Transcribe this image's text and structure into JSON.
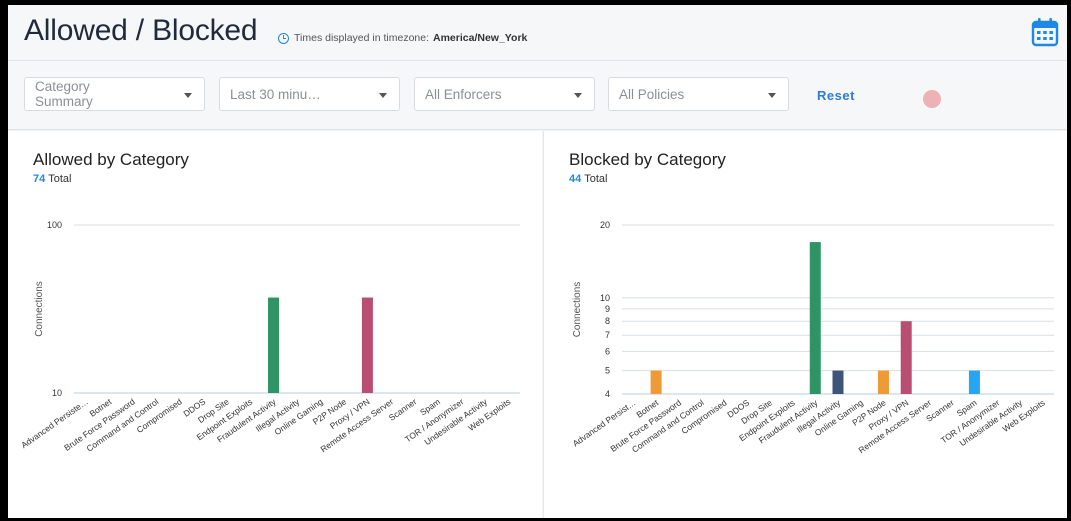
{
  "page": {
    "title": "Allowed / Blocked",
    "tz_label": "Times displayed in timezone:",
    "tz_value": "America/New_York"
  },
  "filters": {
    "category_line1": "Category",
    "category_line2": "Summary",
    "time_range": "Last 30 minu…",
    "enforcers": "All Enforcers",
    "policies": "All Policies",
    "reset_label": "Reset"
  },
  "icons": {
    "timezone": "clock-icon",
    "calendar": "calendar-icon"
  },
  "colors": {
    "accent": "#1e88e5",
    "green": "#2e9464",
    "rose": "#b94e72",
    "orange": "#f09a37",
    "slate": "#3f5577",
    "sky": "#26a6f2"
  },
  "allowed": {
    "title": "Allowed by Category",
    "total": "74",
    "total_label": "Total"
  },
  "blocked": {
    "title": "Blocked by Category",
    "total": "44",
    "total_label": "Total"
  },
  "chart_data": [
    {
      "type": "bar",
      "title": "Allowed by Category",
      "ylabel": "Connections",
      "yscale": "log",
      "ylim": [
        10,
        100
      ],
      "yticks": [
        "10",
        "100"
      ],
      "grid": true,
      "categories": [
        "Advanced Persiste…",
        "Botnet",
        "Brute Force Password",
        "Command and Control",
        "Compromised",
        "DDOS",
        "Drop Site",
        "Endpoint Exploits",
        "Fraudulent Activity",
        "Illegal Activity",
        "Online Gaming",
        "P2P Node",
        "Proxy / VPN",
        "Remote Access Server",
        "Scanner",
        "Spam",
        "TOR / Anonymizer",
        "Undesirable Activity",
        "Web Exploits"
      ],
      "values": [
        0,
        0,
        0,
        0,
        0,
        0,
        0,
        0,
        37,
        0,
        0,
        0,
        37,
        0,
        0,
        0,
        0,
        0,
        0
      ],
      "colors": [
        "",
        "",
        "",
        "",
        "",
        "",
        "",
        "",
        "#2e9464",
        "",
        "",
        "",
        "#b94e72",
        "",
        "",
        "",
        "",
        "",
        ""
      ]
    },
    {
      "type": "bar",
      "title": "Blocked by Category",
      "ylabel": "Connections",
      "yscale": "log",
      "ylim": [
        4,
        20
      ],
      "yticks": [
        "4",
        "5",
        "6",
        "7",
        "8",
        "9",
        "10",
        "20"
      ],
      "grid": true,
      "categories": [
        "Advanced Persist…",
        "Botnet",
        "Brute Force Password",
        "Command and Control",
        "Compromised",
        "DDOS",
        "Drop Site",
        "Endpoint Exploits",
        "Fraudulent Activity",
        "Illegal Activity",
        "Online Gaming",
        "P2P Node",
        "Proxy / VPN",
        "Remote Access Server",
        "Scanner",
        "Spam",
        "TOR / Anonymizer",
        "Undesirable Activity",
        "Web Exploits"
      ],
      "values": [
        0,
        5,
        0,
        0,
        0,
        0,
        0,
        0,
        17,
        5,
        0,
        5,
        8,
        0,
        0,
        5,
        0,
        0,
        0
      ],
      "colors": [
        "",
        "#f09a37",
        "",
        "",
        "",
        "",
        "",
        "",
        "#2e9464",
        "#3f5577",
        "",
        "#f09a37",
        "#b94e72",
        "",
        "",
        "#26a6f2",
        "",
        "",
        ""
      ]
    }
  ]
}
